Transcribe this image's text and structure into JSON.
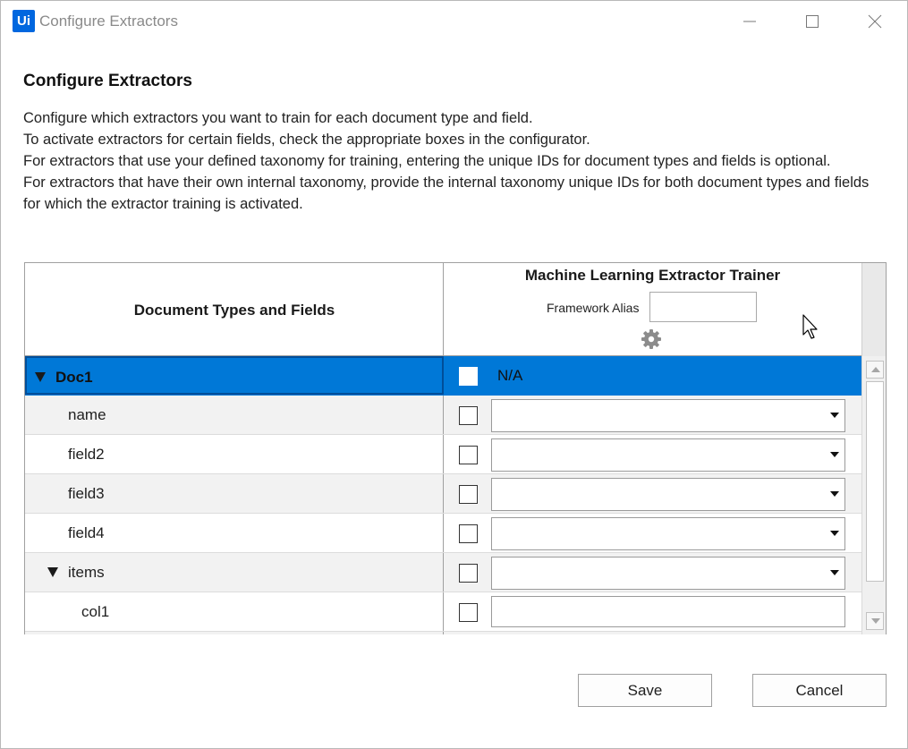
{
  "window": {
    "logo_text": "Ui",
    "title": "Configure Extractors",
    "controls": {
      "minimize": "minimize-icon",
      "maximize": "maximize-icon",
      "close": "close-icon"
    }
  },
  "heading": "Configure Extractors",
  "description": [
    "Configure which extractors you want to train for each document type and field.",
    "To activate extractors for certain fields, check the appropriate boxes in the configurator.",
    "For extractors that use your defined taxonomy for training, entering the unique IDs for document types and fields is optional.",
    "For extractors that have their own internal taxonomy, provide the internal taxonomy unique IDs for both document types and fields for which the extractor training is activated."
  ],
  "grid": {
    "left_header": "Document Types and Fields",
    "extractor_title": "Machine Learning Extractor Trainer",
    "framework_alias_label": "Framework Alias",
    "framework_alias_value": "",
    "rows": [
      {
        "label": "Doc1",
        "checked": false,
        "value": "N/A",
        "selected": true
      },
      {
        "label": "name",
        "checked": false,
        "value": ""
      },
      {
        "label": "field2",
        "checked": false,
        "value": ""
      },
      {
        "label": "field3",
        "checked": false,
        "value": ""
      },
      {
        "label": "field4",
        "checked": false,
        "value": ""
      },
      {
        "label": "items",
        "checked": false,
        "value": ""
      },
      {
        "label": "col1",
        "checked": false,
        "value": ""
      }
    ]
  },
  "buttons": {
    "save": "Save",
    "cancel": "Cancel"
  },
  "colors": {
    "accent": "#0078d7",
    "logo": "#0067df"
  }
}
